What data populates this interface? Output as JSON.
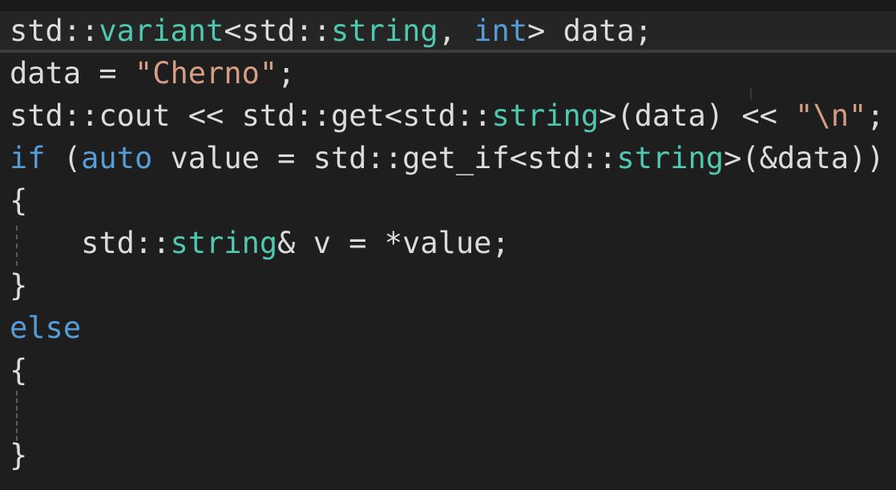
{
  "editor": {
    "lines": [
      [
        {
          "t": "std::",
          "c": "plain"
        },
        {
          "t": "variant",
          "c": "type"
        },
        {
          "t": "<std::",
          "c": "plain"
        },
        {
          "t": "string",
          "c": "type"
        },
        {
          "t": ", ",
          "c": "plain"
        },
        {
          "t": "int",
          "c": "keyword"
        },
        {
          "t": "> data;",
          "c": "plain"
        }
      ],
      [
        {
          "t": "data = ",
          "c": "plain"
        },
        {
          "t": "\"Cherno\"",
          "c": "string"
        },
        {
          "t": ";",
          "c": "plain"
        }
      ],
      [
        {
          "t": "std::cout << std::get<std::",
          "c": "plain"
        },
        {
          "t": "string",
          "c": "type"
        },
        {
          "t": ">(data) << ",
          "c": "plain"
        },
        {
          "t": "\"\\n\"",
          "c": "string"
        },
        {
          "t": ";",
          "c": "plain"
        }
      ],
      [
        {
          "t": "if",
          "c": "keyword"
        },
        {
          "t": " (",
          "c": "plain"
        },
        {
          "t": "auto",
          "c": "keyword"
        },
        {
          "t": " value = std::get_if<std::",
          "c": "plain"
        },
        {
          "t": "string",
          "c": "type"
        },
        {
          "t": ">(&data))",
          "c": "plain"
        }
      ],
      [
        {
          "t": "{",
          "c": "plain"
        }
      ],
      [
        {
          "t": "    std::",
          "c": "plain"
        },
        {
          "t": "string",
          "c": "type"
        },
        {
          "t": "& v = *value;",
          "c": "plain"
        }
      ],
      [
        {
          "t": "}",
          "c": "plain"
        }
      ],
      [
        {
          "t": "else",
          "c": "keyword"
        }
      ],
      [
        {
          "t": "{",
          "c": "plain"
        }
      ],
      [
        {
          "t": "",
          "c": "plain"
        }
      ],
      [
        {
          "t": "}",
          "c": "plain"
        }
      ]
    ]
  },
  "colors": {
    "background": "#1e1e1e",
    "plain": "#dcdcdc",
    "type": "#4ec9b0",
    "keyword": "#569cd6",
    "string": "#d69d85"
  }
}
